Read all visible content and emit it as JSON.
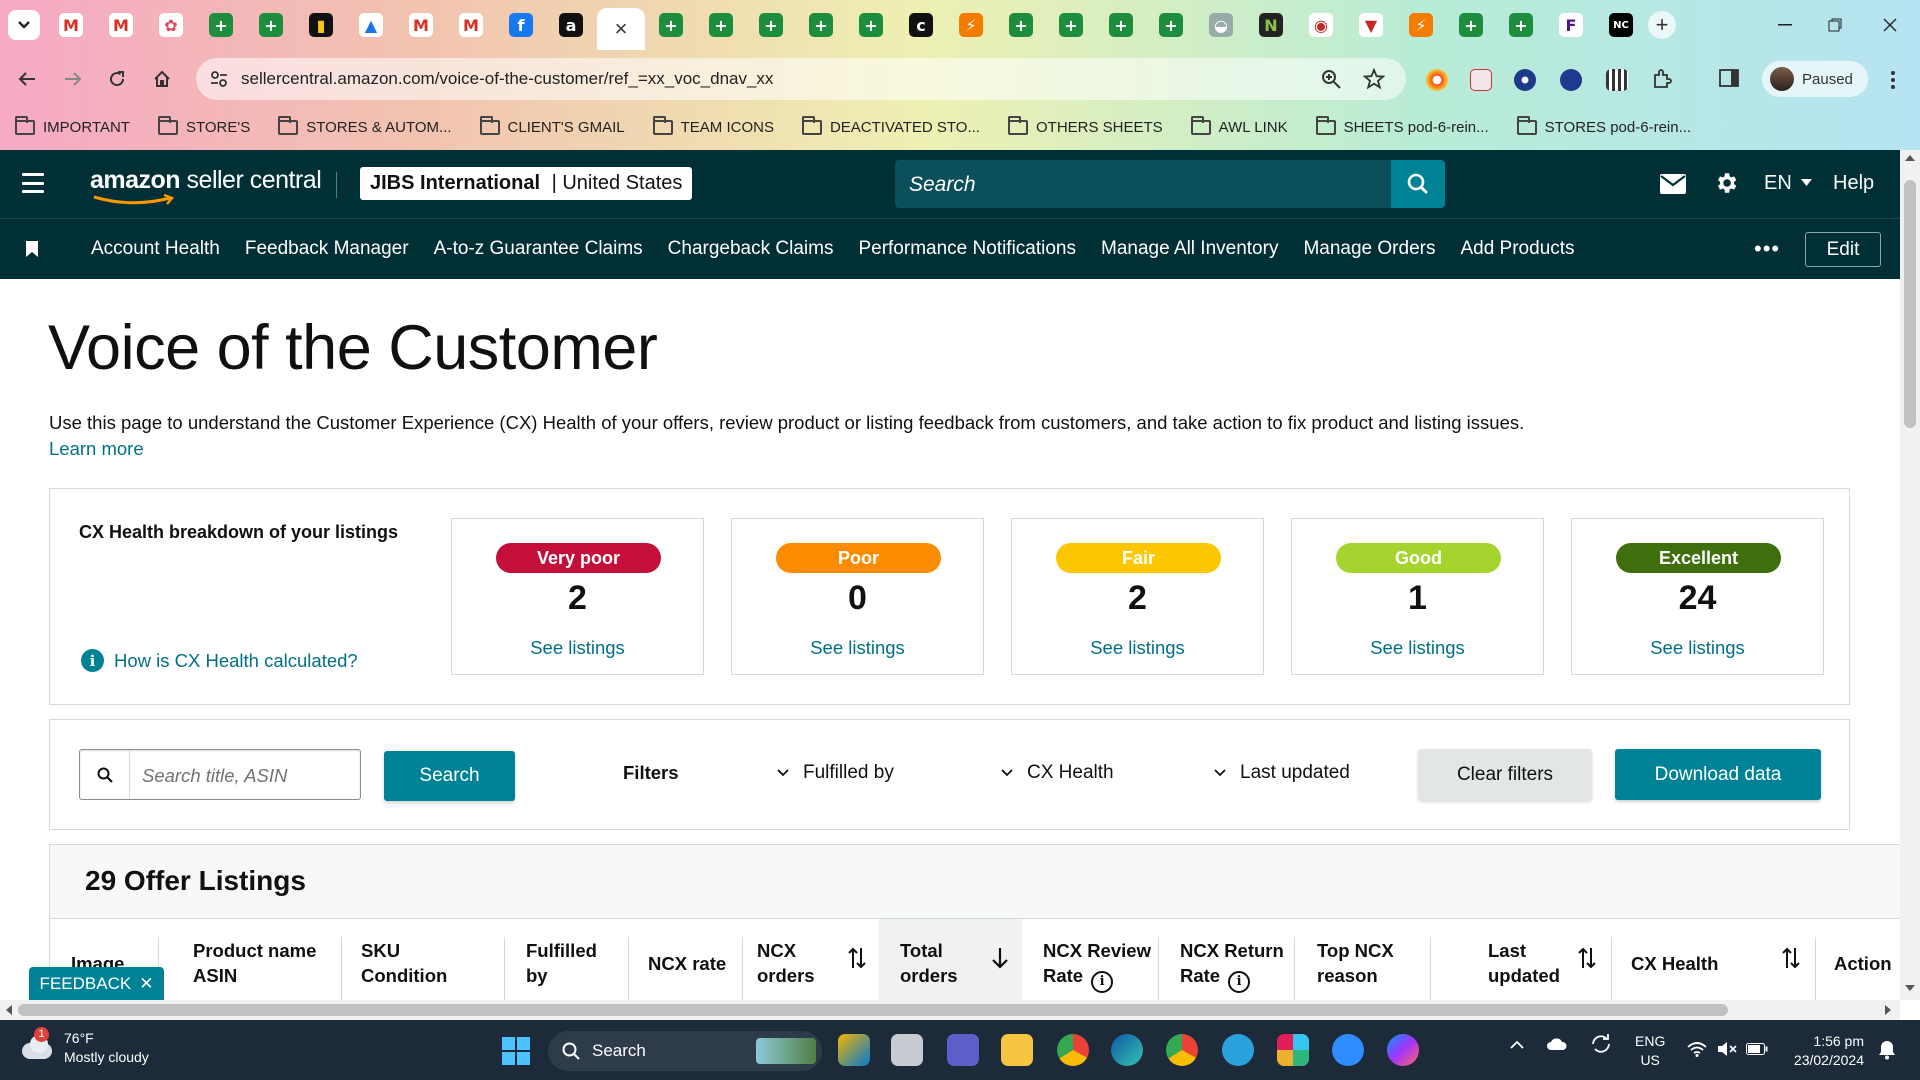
{
  "browser": {
    "url": "sellercentral.amazon.com/voice-of-the-customer/ref_=xx_voc_dnav_xx",
    "profile_label": "Paused",
    "tab_close": "×",
    "bookmarks": [
      "IMPORTANT",
      "STORE'S",
      "STORES & AUTOM...",
      "CLIENT'S GMAIL",
      "TEAM ICONS",
      "DEACTIVATED STO...",
      "OTHERS SHEETS",
      "AWL LINK",
      "SHEETS pod-6-rein...",
      "STORES pod-6-rein..."
    ]
  },
  "header": {
    "brand_bold": "amazon",
    "brand_rest": " seller central",
    "store_name": "JIBS International",
    "store_sep": " | ",
    "store_region": "United States",
    "search_placeholder": "Search",
    "lang": "EN",
    "help": "Help"
  },
  "nav": {
    "links": [
      "Account Health",
      "Feedback Manager",
      "A-to-z Guarantee Claims",
      "Chargeback Claims",
      "Performance Notifications",
      "Manage All Inventory",
      "Manage Orders",
      "Add Products"
    ],
    "more": "•••",
    "edit": "Edit"
  },
  "page": {
    "title": "Voice of the Customer",
    "description": "Use this page to understand the Customer Experience (CX) Health of your offers, review product or listing feedback from customers, and take action to fix product and listing issues.",
    "learn_more": "Learn more"
  },
  "cx_health": {
    "heading": "CX Health breakdown of your listings",
    "how_link": "How is CX Health calculated?",
    "info_glyph": "i",
    "cards": [
      {
        "label": "Very poor",
        "count": "2",
        "link": "See listings",
        "color": "#c40f3a"
      },
      {
        "label": "Poor",
        "count": "0",
        "link": "See listings",
        "color": "#fb8c00"
      },
      {
        "label": "Fair",
        "count": "2",
        "link": "See listings",
        "color": "#fdc700"
      },
      {
        "label": "Good",
        "count": "1",
        "link": "See listings",
        "color": "#a6d42e"
      },
      {
        "label": "Excellent",
        "count": "24",
        "link": "See listings",
        "color": "#3f6e0c"
      }
    ]
  },
  "filters": {
    "search_placeholder": "Search title, ASIN",
    "search_button": "Search",
    "label": "Filters",
    "dropdowns": [
      "Fulfilled by",
      "CX Health",
      "Last updated"
    ],
    "clear": "Clear filters",
    "download": "Download data"
  },
  "listings": {
    "title": "29 Offer Listings",
    "columns": {
      "image": "Image",
      "product_1": "Product name",
      "product_2": "ASIN",
      "sku_1": "SKU",
      "sku_2": "Condition",
      "fulfilled_1": "Fulfilled",
      "fulfilled_2": "by",
      "ncx_rate": "NCX rate",
      "ncx_orders_1": "NCX",
      "ncx_orders_2": "orders",
      "total_1": "Total",
      "total_2": "orders",
      "review_1": "NCX Review",
      "review_2": "Rate",
      "return_1": "NCX Return",
      "return_2": "Rate",
      "top_1": "Top NCX",
      "top_2": "reason",
      "updated_1": "Last",
      "updated_2": "updated",
      "cx_health": "CX Health",
      "action": "Action"
    }
  },
  "feedback_tab": {
    "label": "FEEDBACK",
    "close": "✕"
  },
  "taskbar": {
    "badge": "1",
    "temperature": "76°F",
    "weather": "Mostly cloudy",
    "search": "Search",
    "lang_1": "ENG",
    "lang_2": "US",
    "time": "1:56 pm",
    "date": "23/02/2024"
  },
  "colors": {
    "header_bg": "#002f36",
    "teal": "#008296",
    "link": "#007185"
  }
}
